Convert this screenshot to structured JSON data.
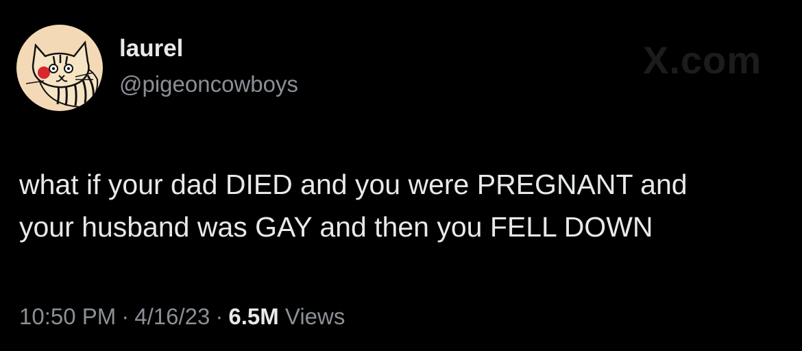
{
  "author": {
    "display_name": "laurel",
    "handle": "@pigeoncowboys",
    "avatar_icon": "cat-avatar-icon"
  },
  "watermark": "X.com",
  "tweet": {
    "line1": "what if your dad DIED and you were PREGNANT and",
    "line2": "your husband was GAY and then you FELL DOWN"
  },
  "meta": {
    "time": "10:50 PM",
    "separator": "·",
    "date": "4/16/23",
    "views_count": "6.5M",
    "views_label": "Views"
  },
  "colors": {
    "background": "#000000",
    "primary_text": "#e7e9ea",
    "secondary_text": "#8b9096",
    "avatar_bg": "#f3d9b5",
    "avatar_accent": "#d9262c"
  }
}
